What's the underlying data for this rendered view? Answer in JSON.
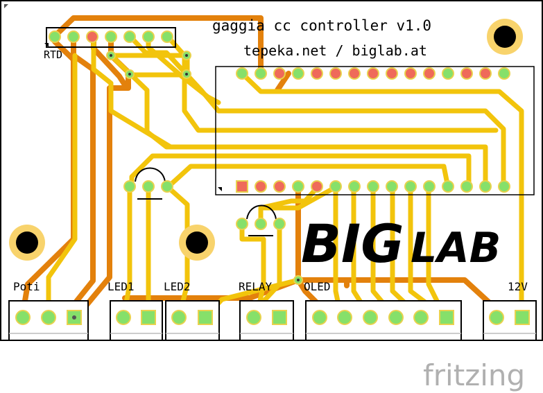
{
  "board": {
    "title": "gaggia cc controller v1.0",
    "credits": "tepeka.net / biglab.at",
    "logo_big": "BIG",
    "logo_small": "LAB",
    "brand": "fritzing",
    "header_label": "RTD",
    "connectors": [
      {
        "id": "poti",
        "label": "Poti"
      },
      {
        "id": "led1",
        "label": "LED1"
      },
      {
        "id": "led2",
        "label": "LED2"
      },
      {
        "id": "relay",
        "label": "RELAY"
      },
      {
        "id": "oled",
        "label": "OLED"
      },
      {
        "id": "power",
        "label": "12V"
      }
    ]
  },
  "colors": {
    "trace_top": "#f2c40c",
    "trace_bottom": "#e3810c",
    "pad_green": "#86e06a",
    "pad_red": "#ef6a5a",
    "pad_ring": "#e9d24d",
    "mount_ring": "#f8d36c",
    "silkscreen": "#000000",
    "brand_gray": "#b0b0b0"
  }
}
